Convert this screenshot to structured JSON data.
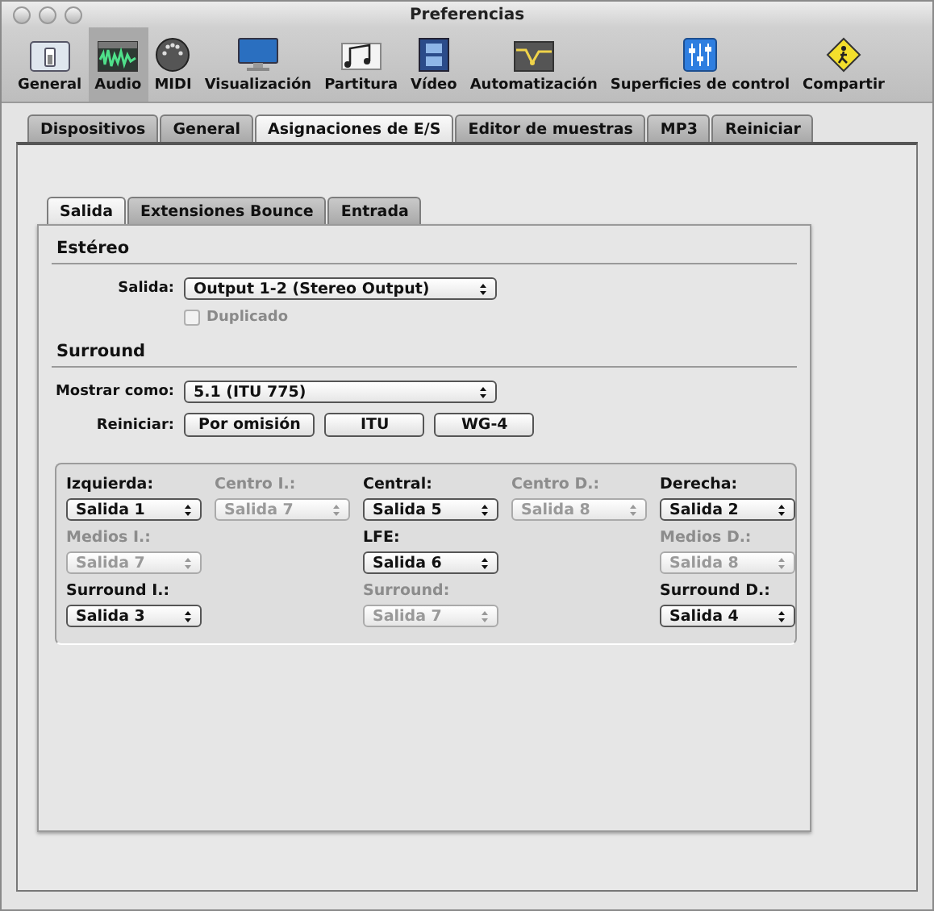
{
  "window": {
    "title": "Preferencias"
  },
  "toolbar": [
    {
      "label": "General",
      "selected": false
    },
    {
      "label": "Audio",
      "selected": true
    },
    {
      "label": "MIDI",
      "selected": false
    },
    {
      "label": "Visualización",
      "selected": false
    },
    {
      "label": "Partitura",
      "selected": false
    },
    {
      "label": "Vídeo",
      "selected": false
    },
    {
      "label": "Automatización",
      "selected": false
    },
    {
      "label": "Superficies de control",
      "selected": false
    },
    {
      "label": "Compartir",
      "selected": false
    }
  ],
  "tabs": [
    {
      "label": "Dispositivos",
      "selected": false
    },
    {
      "label": "General",
      "selected": false
    },
    {
      "label": "Asignaciones de E/S",
      "selected": true
    },
    {
      "label": "Editor de muestras",
      "selected": false
    },
    {
      "label": "MP3",
      "selected": false
    },
    {
      "label": "Reiniciar",
      "selected": false
    }
  ],
  "subtabs": [
    {
      "label": "Salida",
      "selected": true
    },
    {
      "label": "Extensiones Bounce",
      "selected": false
    },
    {
      "label": "Entrada",
      "selected": false
    }
  ],
  "stereo": {
    "heading": "Estéreo",
    "output_label": "Salida:",
    "output_value": "Output 1-2  (Stereo Output)",
    "duplicate": {
      "label": "Duplicado",
      "checked": false,
      "disabled": true
    }
  },
  "surround": {
    "heading": "Surround",
    "show_as_label": "Mostrar como:",
    "show_as_value": "5.1 (ITU 775)",
    "reset_label": "Reiniciar:",
    "reset_buttons": [
      "Por omisión",
      "ITU",
      "WG-4"
    ],
    "grid": [
      [
        {
          "kind": "channel",
          "label": "Izquierda:",
          "value": "Salida 1",
          "disabled": false
        },
        {
          "kind": "channel",
          "label": "Centro I.:",
          "value": "Salida 7",
          "disabled": true
        },
        {
          "kind": "channel",
          "label": "Central:",
          "value": "Salida 5",
          "disabled": false
        },
        {
          "kind": "channel",
          "label": "Centro D.:",
          "value": "Salida 8",
          "disabled": true
        },
        {
          "kind": "channel",
          "label": "Derecha:",
          "value": "Salida 2",
          "disabled": false
        }
      ],
      [
        {
          "kind": "channel",
          "label": "Medios I.:",
          "value": "Salida 7",
          "disabled": true
        },
        {
          "kind": "blank"
        },
        {
          "kind": "channel",
          "label": "LFE:",
          "value": "Salida 6",
          "disabled": false
        },
        {
          "kind": "blank"
        },
        {
          "kind": "channel",
          "label": "Medios D.:",
          "value": "Salida 8",
          "disabled": true
        }
      ],
      [
        {
          "kind": "channel",
          "label": "Surround I.:",
          "value": "Salida 3",
          "disabled": false
        },
        {
          "kind": "blank"
        },
        {
          "kind": "channel",
          "label": "Surround:",
          "value": "Salida 7",
          "disabled": true
        },
        {
          "kind": "blank"
        },
        {
          "kind": "channel",
          "label": "Surround D.:",
          "value": "Salida 4",
          "disabled": false
        }
      ]
    ]
  }
}
